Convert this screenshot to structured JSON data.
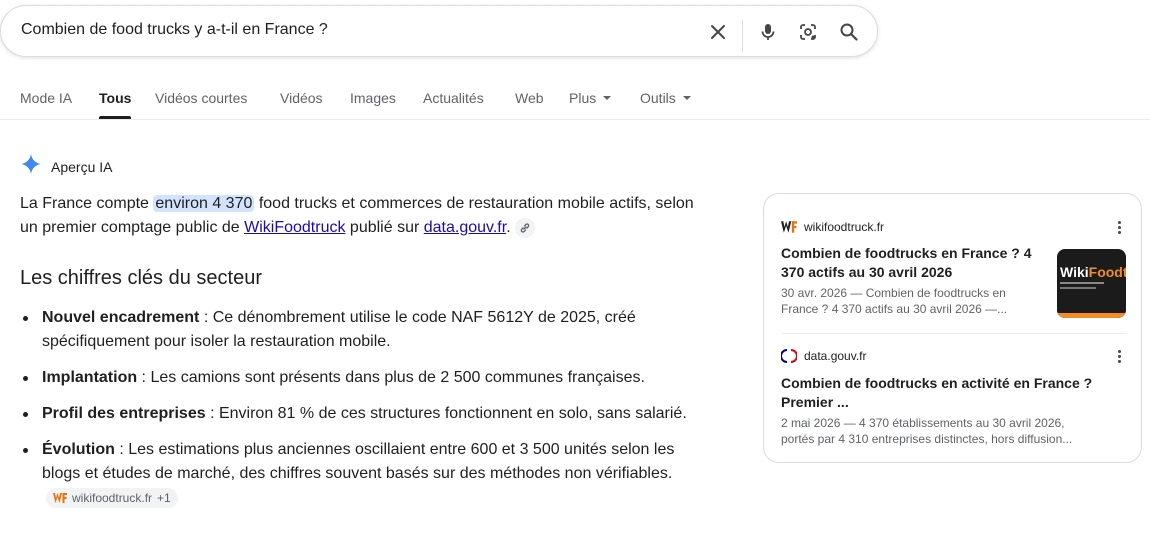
{
  "search": {
    "query": "Combien de food trucks y a-t-il en France ?"
  },
  "tabs": [
    {
      "label": "Mode IA"
    },
    {
      "label": "Tous"
    },
    {
      "label": "Vidéos courtes"
    },
    {
      "label": "Vidéos"
    },
    {
      "label": "Images"
    },
    {
      "label": "Actualités"
    },
    {
      "label": "Web"
    },
    {
      "label": "Plus"
    },
    {
      "label": "Outils"
    }
  ],
  "ai_overview": {
    "label": "Aperçu IA",
    "intro": {
      "p1": "La France compte ",
      "highlight": "environ 4 370",
      "p2": " food trucks et commerces de restauration mobile actifs, selon un premier comptage public de ",
      "link1": "WikiFoodtruck",
      "p3": " publié sur ",
      "link2": "data.gouv.fr",
      "p4": "."
    },
    "heading": "Les chiffres clés du secteur",
    "bullets": [
      {
        "title": "Nouvel encadrement",
        "text": " : Ce dénombrement utilise le code NAF 5612Y de 2025, créé spécifiquement pour isoler la restauration mobile."
      },
      {
        "title": "Implantation",
        "text": " : Les camions sont présents dans plus de 2 500 communes françaises."
      },
      {
        "title": "Profil des entreprises",
        "text": " : Environ 81 % de ces structures fonctionnent en solo, sans salarié."
      },
      {
        "title": "Évolution",
        "text": " : Les estimations plus anciennes oscillaient entre 600 et 3 500 unités selon les blogs et études de marché, des chiffres souvent basés sur des méthodes non vérifiables."
      }
    ],
    "chip": {
      "source": "wikifoodtruck.fr",
      "more": "+1"
    }
  },
  "sources": [
    {
      "site": "wikifoodtruck.fr",
      "title": "Combien de foodtrucks en France ? 4 370 actifs au 30 avril 2026",
      "snippet": "30 avr. 2026 — Combien de foodtrucks en France ? 4 370 actifs au 30 avril 2026 —...",
      "thumb_a": "Wiki",
      "thumb_b": "Foodtr"
    },
    {
      "site": "data.gouv.fr",
      "title": "Combien de foodtrucks en activité en France ? Premier ...",
      "snippet": "2 mai 2026 — 4 370 établissements au 30 avril 2026, portés par 4 310 entreprises distinctes, hors diffusion..."
    }
  ],
  "colors": {
    "link": "#1a0dab",
    "highlight": "#d3e3fd",
    "gemini_blue": "#4285f4",
    "brand_orange": "#f28c28"
  },
  "icons": [
    "clear-icon",
    "microphone-icon",
    "lens-icon",
    "search-icon",
    "gemini-sparkle-icon",
    "link-icon",
    "more-vert-icon"
  ]
}
